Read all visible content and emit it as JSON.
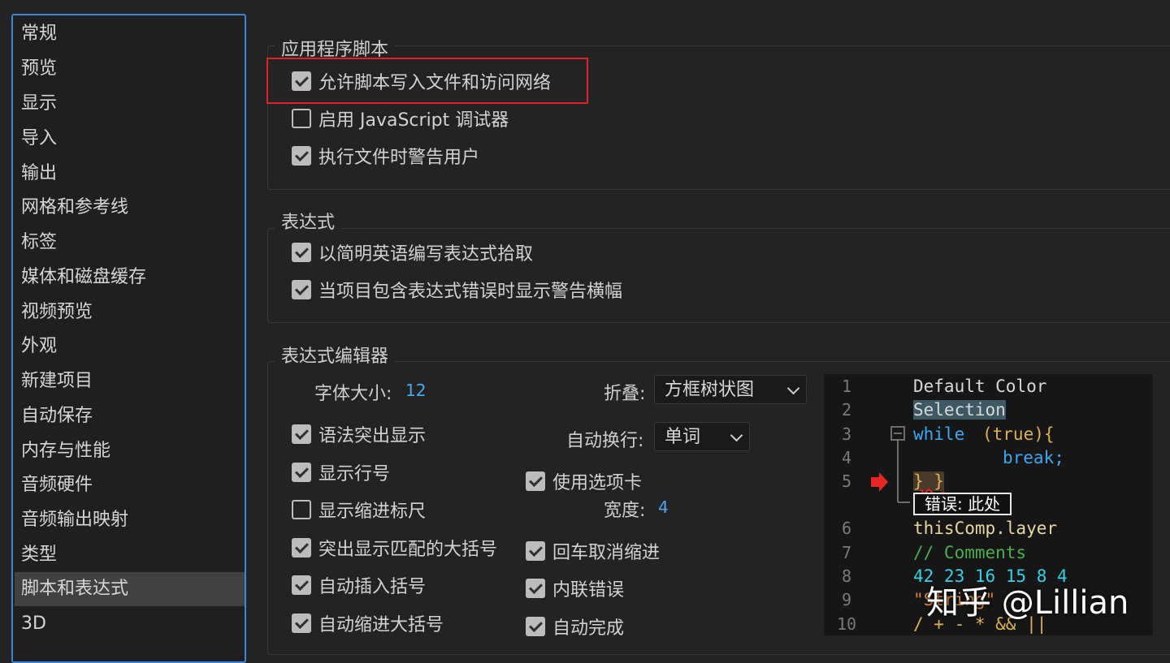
{
  "sidebar": {
    "items": [
      "常规",
      "预览",
      "显示",
      "导入",
      "输出",
      "网格和参考线",
      "标签",
      "媒体和磁盘缓存",
      "视频预览",
      "外观",
      "新建项目",
      "自动保存",
      "内存与性能",
      "音频硬件",
      "音频输出映射",
      "类型",
      "脚本和表达式",
      "3D"
    ],
    "selected": "脚本和表达式"
  },
  "scripting": {
    "title": "应用程序脚本",
    "allow_write": "允许脚本写入文件和访问网络",
    "enable_debugger": "启用 JavaScript 调试器",
    "warn_user": "执行文件时警告用户"
  },
  "expressions": {
    "title": "表达式",
    "plain_english": "以简明英语编写表达式拾取",
    "warn_banner": "当项目包含表达式错误时显示警告横幅"
  },
  "editor": {
    "title": "表达式编辑器",
    "font_size_label": "字体大小:",
    "font_size_value": "12",
    "fold_label": "折叠:",
    "fold_value": "方框树状图",
    "wrap_label": "自动换行:",
    "wrap_value": "单词",
    "syntax_highlight": "语法突出显示",
    "line_numbers": "显示行号",
    "indent_guides": "显示缩进标尺",
    "match_brackets": "突出显示匹配的大括号",
    "auto_insert": "自动插入括号",
    "auto_indent": "自动缩进大括号",
    "use_tabs": "使用选项卡",
    "width_label": "宽度:",
    "width_value": "4",
    "enter_unindent": "回车取消缩进",
    "inline_errors": "内联错误",
    "autocomplete": "自动完成"
  },
  "preview": {
    "line_numbers": [
      "1",
      "2",
      "3",
      "4",
      "5",
      "6",
      "7",
      "8",
      "9",
      "10"
    ],
    "default_color": "Default Color",
    "selection": "Selection",
    "kw_while": "while",
    "paren_true": "(true){",
    "kw_break": "break;",
    "close_braces": "} }",
    "error_box": "错误: 此处",
    "this_comp": "thisComp.layer",
    "comment": "// Comments",
    "numbers": "42 23 16 15 8 4",
    "string": "\"String\"",
    "operators": "/ + - * && ||"
  },
  "watermark": "知乎 @Lillian",
  "colors": {
    "accent_blue": "#3b84d6",
    "highlight_red": "#e0202a",
    "number_blue": "#4ea6ee",
    "keyword_blue": "#3ea7f0",
    "paren_gold": "#d9b25a",
    "comment_green": "#4caf50",
    "number_cyan": "#3ad0e8"
  }
}
